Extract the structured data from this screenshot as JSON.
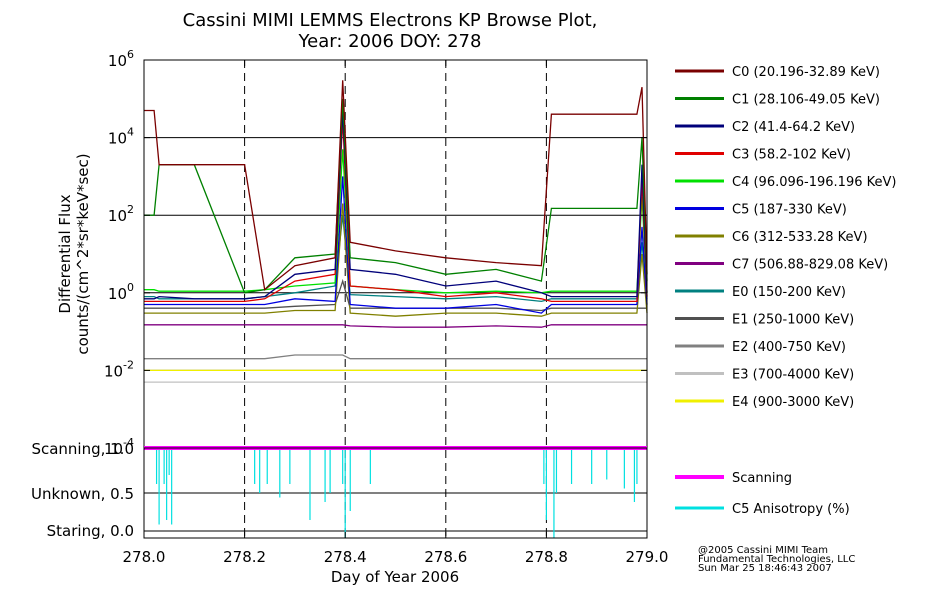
{
  "title_lines": [
    "Cassini MIMI LEMMS Electrons KP Browse Plot,",
    "Year: 2006 DOY: 278"
  ],
  "credits": [
    "@2005 Cassini MIMI Team",
    "Fundamental Technologies, LLC",
    "Sun Mar 25 18:46:43 2007"
  ],
  "chart_data": [
    {
      "type": "line",
      "panel": "flux",
      "xlabel": "Day of Year 2006",
      "ylabel": [
        "Differential Flux",
        "counts/(cm^2*sr*keV*sec)"
      ],
      "ylabel_lines": [
        "Differential Flux",
        "counts/(cm^2*sr*keV*sec)"
      ],
      "xlim": [
        278.0,
        279.0
      ],
      "ylim": [
        0.0001,
        1000000
      ],
      "yscale": "log",
      "x_ticks": [
        "278.0",
        "278.2",
        "278.4",
        "278.6",
        "278.8",
        "279.0"
      ],
      "y_tick_exponents": [
        "-4",
        "-2",
        "0",
        "2",
        "4",
        "6"
      ],
      "grid": "horizontal solid at decades, vertical dashed at x ticks",
      "legend_position": "right",
      "x": [
        278.0,
        278.02,
        278.03,
        278.1,
        278.2,
        278.24,
        278.3,
        278.38,
        278.395,
        278.41,
        278.5,
        278.6,
        278.7,
        278.79,
        278.81,
        278.9,
        278.98,
        278.99,
        279.0
      ],
      "series": [
        {
          "name": "C0 (20.196-32.89 KeV)",
          "color": "#7a0000",
          "values": [
            50000,
            50000,
            2000,
            2000,
            2000,
            1.2,
            5,
            8,
            300000,
            20,
            12,
            8,
            6,
            5,
            40000,
            40000,
            40000,
            200000,
            3
          ]
        },
        {
          "name": "C1 (28.106-49.05 KeV)",
          "color": "#008000",
          "values": [
            100,
            100,
            2000,
            2000,
            1,
            1.2,
            8,
            10,
            100000,
            8,
            6,
            3,
            4,
            2,
            150,
            150,
            150,
            10000,
            2
          ]
        },
        {
          "name": "C2 (41.4-64.2 KeV)",
          "color": "#00007a",
          "values": [
            0.7,
            0.7,
            0.8,
            0.7,
            0.7,
            0.8,
            3,
            4,
            50000,
            4,
            3,
            1.5,
            2,
            1,
            0.8,
            0.8,
            0.8,
            2000,
            1
          ]
        },
        {
          "name": "C3 (58.2-102 KeV)",
          "color": "#e00000",
          "values": [
            0.6,
            0.6,
            0.6,
            0.6,
            0.6,
            0.7,
            2,
            3,
            30000,
            1.5,
            1.2,
            0.8,
            1,
            0.7,
            0.6,
            0.6,
            0.6,
            800,
            0.8
          ]
        },
        {
          "name": "C4 (96.096-196.196 KeV)",
          "color": "#00e000",
          "values": [
            1.2,
            1.2,
            1.1,
            1.1,
            1.1,
            1.2,
            1.5,
            1.8,
            5000,
            1.5,
            1.2,
            1,
            1.1,
            1,
            1.1,
            1.1,
            1.1,
            300,
            1
          ]
        },
        {
          "name": "C5 (187-330 KeV)",
          "color": "#0000e0",
          "values": [
            0.5,
            0.5,
            0.5,
            0.5,
            0.5,
            0.5,
            0.7,
            0.6,
            1000,
            0.5,
            0.4,
            0.4,
            0.5,
            0.3,
            0.5,
            0.5,
            0.5,
            50,
            0.5
          ]
        },
        {
          "name": "C6 (312-533.28 KeV)",
          "color": "#808000",
          "values": [
            0.3,
            0.3,
            0.3,
            0.3,
            0.3,
            0.3,
            0.35,
            0.35,
            200,
            0.3,
            0.25,
            0.3,
            0.3,
            0.25,
            0.3,
            0.3,
            0.3,
            10,
            0.3
          ]
        },
        {
          "name": "C7 (506.88-829.08 KeV)",
          "color": "#800080",
          "values": [
            0.15,
            0.15,
            0.15,
            0.15,
            0.15,
            0.15,
            0.15,
            0.15,
            0.15,
            0.14,
            0.13,
            0.13,
            0.14,
            0.13,
            0.15,
            0.15,
            0.15,
            0.15,
            0.15
          ]
        },
        {
          "name": "E0 (150-200 KeV)",
          "color": "#008080",
          "values": [
            0.8,
            0.8,
            0.7,
            0.7,
            0.7,
            0.8,
            1,
            1.5,
            100,
            0.9,
            0.8,
            0.7,
            0.8,
            0.6,
            0.7,
            0.7,
            0.7,
            20,
            0.7
          ]
        },
        {
          "name": "E1 (250-1000 KeV)",
          "color": "#505050",
          "values": [
            0.4,
            0.4,
            0.4,
            0.4,
            0.4,
            0.4,
            0.45,
            0.5,
            2,
            0.4,
            0.4,
            0.4,
            0.4,
            0.35,
            0.4,
            0.4,
            0.4,
            0.4,
            0.4
          ]
        },
        {
          "name": "E2 (400-750 KeV)",
          "color": "#808080",
          "values": [
            0.02,
            0.02,
            0.02,
            0.02,
            0.02,
            0.02,
            0.025,
            0.025,
            0.025,
            0.02,
            0.02,
            0.02,
            0.02,
            0.02,
            0.02,
            0.02,
            0.02,
            0.02,
            0.02
          ]
        },
        {
          "name": "E3 (700-4000 KeV)",
          "color": "#c0c0c0",
          "values": [
            0.005,
            0.005,
            0.005,
            0.005,
            0.005,
            0.005,
            0.005,
            0.005,
            0.005,
            0.005,
            0.005,
            0.005,
            0.005,
            0.005,
            0.005,
            0.005,
            0.005,
            0.005,
            0.005
          ]
        },
        {
          "name": "E4 (900-3000 KeV)",
          "color": "#f0f000",
          "values": [
            0.01,
            0.01,
            0.01,
            0.01,
            0.01,
            0.01,
            0.01,
            0.01,
            0.01,
            0.01,
            0.01,
            0.01,
            0.01,
            0.01,
            0.01,
            0.01,
            0.01,
            0.01,
            0.01
          ]
        }
      ]
    },
    {
      "type": "line",
      "panel": "mode",
      "xlim": [
        278.0,
        279.0
      ],
      "ylim": [
        0.0,
        1.0
      ],
      "y_tick_labels": [
        "Staring, 0.0",
        "Unknown, 0.5",
        "Scanning, 1.0"
      ],
      "grid": "horizontal solid at 0.0, 0.5, 1.0",
      "legend_position": "right",
      "series": [
        {
          "name": "Scanning",
          "color": "#ff00ff",
          "x": [
            278.0,
            279.0
          ],
          "values": [
            1.0,
            1.0
          ]
        },
        {
          "name": "C5 Anisotropy (%)",
          "color": "#00e0e0",
          "spikes": [
            {
              "x": 278.025,
              "y": 0.6
            },
            {
              "x": 278.03,
              "y": 0.15
            },
            {
              "x": 278.04,
              "y": 0.6
            },
            {
              "x": 278.045,
              "y": 0.2
            },
            {
              "x": 278.05,
              "y": 0.7
            },
            {
              "x": 278.055,
              "y": 0.15
            },
            {
              "x": 278.22,
              "y": 0.6
            },
            {
              "x": 278.23,
              "y": 0.5
            },
            {
              "x": 278.245,
              "y": 0.6
            },
            {
              "x": 278.27,
              "y": 0.45
            },
            {
              "x": 278.29,
              "y": 0.6
            },
            {
              "x": 278.33,
              "y": 0.2
            },
            {
              "x": 278.36,
              "y": 0.4
            },
            {
              "x": 278.37,
              "y": 0.5
            },
            {
              "x": 278.395,
              "y": 0.6
            },
            {
              "x": 278.4,
              "y": 0.0
            },
            {
              "x": 278.41,
              "y": 0.3
            },
            {
              "x": 278.45,
              "y": 0.6
            },
            {
              "x": 278.795,
              "y": 0.6
            },
            {
              "x": 278.8,
              "y": 0.2
            },
            {
              "x": 278.815,
              "y": 0.0
            },
            {
              "x": 278.82,
              "y": 0.5
            },
            {
              "x": 278.85,
              "y": 0.6
            },
            {
              "x": 278.89,
              "y": 0.6
            },
            {
              "x": 278.92,
              "y": 0.65
            },
            {
              "x": 278.955,
              "y": 0.55
            },
            {
              "x": 278.975,
              "y": 0.4
            },
            {
              "x": 278.98,
              "y": 0.6
            }
          ]
        }
      ]
    }
  ]
}
